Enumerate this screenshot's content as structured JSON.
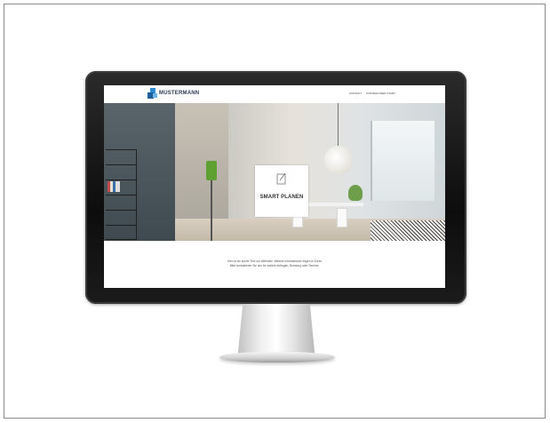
{
  "site": {
    "logo_text": "MUSTERMANN",
    "nav": [
      "KONTAKT",
      "KOSTENLOSER START"
    ],
    "hero_card_label": "SMART PLANEN",
    "intro_lines": [
      "Hier ist ein kurzer Text zur Webseite. Weitere Informationen folgen in Kürze",
      "Bitte kontaktieren Sie uns für weitere Anfragen, Beratung oder Termine."
    ]
  },
  "colors": {
    "logo_blue": "#2e8bd3",
    "lamp_green": "#5fa032",
    "monitor_bezel": "#111111"
  },
  "icons": {
    "hero_card_icon": "pencil-note-icon"
  }
}
